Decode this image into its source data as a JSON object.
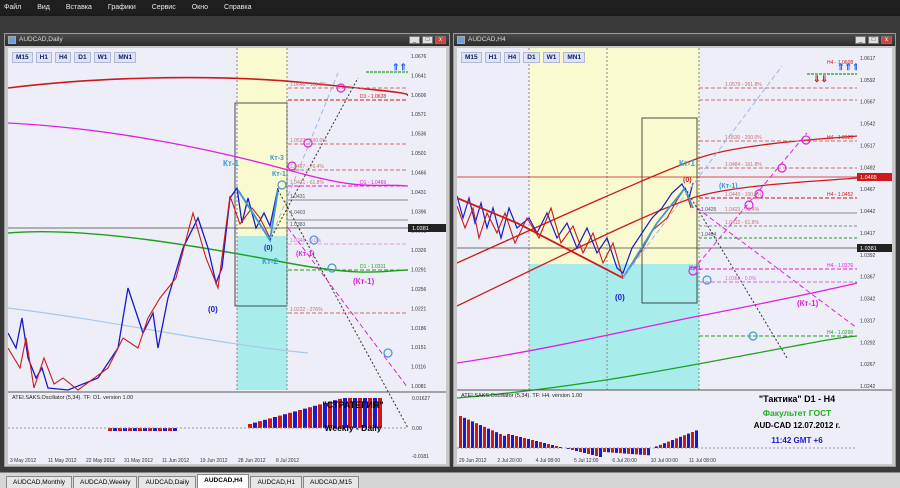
{
  "menu": [
    "Файл",
    "Вид",
    "Вставка",
    "Графики",
    "Сервис",
    "Окно",
    "Справка"
  ],
  "left_window": {
    "title": "AUDCAD,Daily",
    "timeframes": [
      "M15",
      "H1",
      "H4",
      "D1",
      "W1",
      "MN1"
    ],
    "price_scale": [
      "1.0676",
      "1.0641",
      "1.0606",
      "1.0571",
      "1.0536",
      "1.0501",
      "1.0466",
      "1.0431",
      "1.0396",
      "1.0361",
      "1.0326",
      "1.0291",
      "1.0256",
      "1.0221",
      "1.0186",
      "1.0151",
      "1.0116",
      "1.0081"
    ],
    "current_price": "1.0381",
    "level_labels": [
      "1.0648 - 161.8%",
      "D1 - 1.0628",
      "1.0537 - 100.0%",
      "1.0497 - 76.4%",
      "1.0471 - 61.8%",
      "D1 - 1.0469",
      "1.0431",
      "1.0403",
      "1.0383",
      "1.0346 - 0.0%",
      "D1 - 1.0311",
      "1.0222 - 276%"
    ],
    "wave_labels": [
      "Кт-1",
      "Кт-3",
      "Кт-1",
      "(0)",
      "Кт-2",
      "(Кт-1)",
      "(Кт-1)",
      "(0)"
    ],
    "oscillator_label": "ATEI.SAKS.Oscillator (5,34). TF: D1. version 1.00",
    "osc_scale": [
      "0.01627",
      "0.00",
      "-0.0181"
    ],
    "time_axis": [
      "3 May 2012",
      "11 May 2012",
      "22 May 2012",
      "31 May 2012",
      "11 Jun 2012",
      "19 Jun 2012",
      "28 Jun 2012",
      "8 Jul 2012"
    ],
    "overlay_title": "\"СТРАТЕГИЯ\"",
    "overlay_subtitle": "Weekly - Daily"
  },
  "right_window": {
    "title": "AUDCAD,H4",
    "timeframes": [
      "M15",
      "H1",
      "H4",
      "D1",
      "W1",
      "MN1"
    ],
    "price_scale": [
      "1.0617",
      "1.0592",
      "1.0567",
      "1.0542",
      "1.0517",
      "1.0492",
      "1.0467",
      "1.0442",
      "1.0417",
      "1.0392",
      "1.0367",
      "1.0342",
      "1.0317",
      "1.0292",
      "1.0267",
      "1.0242"
    ],
    "current_price": "1.0381",
    "price_tag": "1.0465",
    "level_labels": [
      "H4 - 1.0608",
      "1.0579 - 261.8%",
      "1.0530 - 200.0%",
      "H4 - 1.0529",
      "1.0484 - 161.8%",
      "1.0443 - 100.0%",
      "H4 - 1.0452",
      "1.0425",
      "1.0423 - 76.4%",
      "1.0412 - 61.8%",
      "1.0404",
      "H4 - 1.0376",
      "1.0362 - 0.0%",
      "H4 - 1.0299"
    ],
    "wave_labels": [
      "Кт-1",
      "(0)",
      "(Кт-1)",
      "Кт-1",
      "(0)",
      "(Кт-1)"
    ],
    "oscillator_label": "ATEI.SAKS.Oscillator (5,34). TF: H4. version 1.00",
    "time_axis": [
      "29 Jun 2012",
      "2 Jul 20:00",
      "4 Jul 08:00",
      "5 Jul 12:00",
      "6 Jul 20:00",
      "10 Jul 00:00",
      "11 Jul 08:00"
    ],
    "overlay_title": "\"Тактика\"  D1 - H4",
    "overlay_faculty": "Факультет ГОСТ",
    "overlay_pair": "AUD-CAD  12.07.2012  г.",
    "overlay_time": "11:42  GMT +6"
  },
  "tabs": [
    "AUDCAD,Monthly",
    "AUDCAD,Weekly",
    "AUDCAD,Daily",
    "AUDCAD,H4",
    "AUDCAD,H1",
    "AUDCAD,M15"
  ],
  "active_tab": "AUDCAD,H4",
  "window_buttons": [
    "_",
    "□",
    "x"
  ],
  "colors": {
    "bull": "#1a1acc",
    "bear": "#cc1a1a",
    "magenta": "#e020e0",
    "green": "#20a020",
    "cyan": "#a8ecec",
    "yellow": "#fafad0",
    "accent": "#3a9ad8"
  }
}
